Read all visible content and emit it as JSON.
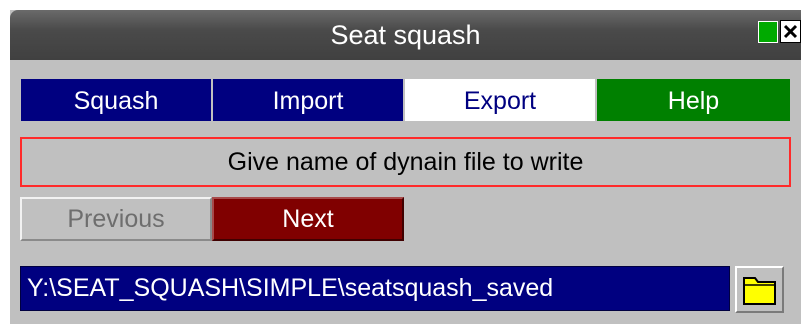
{
  "window": {
    "title": "Seat squash",
    "controls": [
      {
        "name": "green-indicator",
        "color": "#00aa00"
      },
      {
        "name": "close",
        "icon": "close-icon"
      }
    ]
  },
  "tabs": [
    {
      "label": "Squash",
      "state": "normal",
      "color": "#000080"
    },
    {
      "label": "Import",
      "state": "normal",
      "color": "#000080"
    },
    {
      "label": "Export",
      "state": "selected",
      "color": "#ffffff"
    },
    {
      "label": "Help",
      "state": "normal",
      "color": "#008000"
    }
  ],
  "message": "Give name of dynain file to write",
  "nav": {
    "previous_label": "Previous",
    "previous_state": "disabled",
    "next_label": "Next"
  },
  "file": {
    "path": "Y:\\SEAT_SQUASH\\SIMPLE\\seatsquash_saved",
    "browse_icon": "folder-icon"
  },
  "colors": {
    "panel": "#c0c0c0",
    "field_bg": "#000080",
    "message_border": "#ff2a2a",
    "next_bg": "#800000"
  }
}
